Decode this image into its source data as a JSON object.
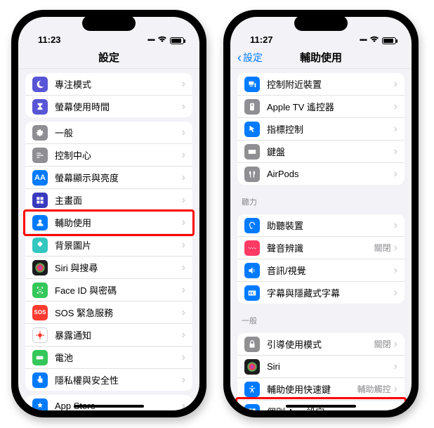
{
  "left": {
    "time": "11:23",
    "title": "設定",
    "groups": [
      {
        "rows": [
          {
            "id": "focus",
            "label": "專注模式",
            "icon": "moon",
            "color": "#5856d6"
          },
          {
            "id": "screentime",
            "label": "螢幕使用時間",
            "icon": "hourglass",
            "color": "#5856d6"
          }
        ]
      },
      {
        "rows": [
          {
            "id": "general",
            "label": "一般",
            "icon": "gear",
            "color": "#8e8e93"
          },
          {
            "id": "controlcenter",
            "label": "控制中心",
            "icon": "sliders",
            "color": "#8e8e93"
          },
          {
            "id": "display",
            "label": "螢幕顯示與亮度",
            "icon": "aa",
            "color": "#007aff"
          },
          {
            "id": "homescreen",
            "label": "主畫面",
            "icon": "grid",
            "color": "#3a3abf"
          },
          {
            "id": "accessibility",
            "label": "輔助使用",
            "icon": "person",
            "color": "#007aff",
            "highlight": true
          },
          {
            "id": "wallpaper",
            "label": "背景圖片",
            "icon": "flower",
            "color": "#34c7c0"
          },
          {
            "id": "siri",
            "label": "Siri 與搜尋",
            "icon": "siri",
            "color": "#1c1c1e"
          },
          {
            "id": "faceid",
            "label": "Face ID 與密碼",
            "icon": "face",
            "color": "#34c759"
          },
          {
            "id": "sos",
            "label": "SOS 緊急服務",
            "icon": "sos",
            "color": "#ff3b30",
            "text": "SOS"
          },
          {
            "id": "exposure",
            "label": "暴露通知",
            "icon": "virus",
            "color": "#ffffff",
            "border": true
          },
          {
            "id": "battery",
            "label": "電池",
            "icon": "batt",
            "color": "#34c759"
          },
          {
            "id": "privacy",
            "label": "隱私權與安全性",
            "icon": "hand",
            "color": "#007aff"
          }
        ]
      },
      {
        "rows": [
          {
            "id": "appstore",
            "label": "App Store",
            "icon": "astore",
            "color": "#007aff"
          }
        ]
      }
    ]
  },
  "right": {
    "time": "11:27",
    "back": "設定",
    "title": "輔助使用",
    "sections": [
      {
        "header": null,
        "rows": [
          {
            "id": "nearby",
            "label": "控制附近裝置",
            "icon": "devices",
            "color": "#007aff"
          },
          {
            "id": "appletv",
            "label": "Apple TV 遙控器",
            "icon": "remote",
            "color": "#8e8e93"
          },
          {
            "id": "pointer",
            "label": "指標控制",
            "icon": "pointer",
            "color": "#007aff"
          },
          {
            "id": "keyboard",
            "label": "鍵盤",
            "icon": "kbd",
            "color": "#8e8e93"
          },
          {
            "id": "airpods",
            "label": "AirPods",
            "icon": "airpods",
            "color": "#8e8e93"
          }
        ]
      },
      {
        "header": "聽力",
        "rows": [
          {
            "id": "hearing",
            "label": "助聽裝置",
            "icon": "ear",
            "color": "#007aff"
          },
          {
            "id": "soundrec",
            "label": "聲音辨識",
            "icon": "wave",
            "color": "#ff3b65",
            "value": "關閉"
          },
          {
            "id": "audiovis",
            "label": "音訊/視覺",
            "icon": "speaker",
            "color": "#007aff"
          },
          {
            "id": "subtitles",
            "label": "字幕與隱藏式字幕",
            "icon": "cc",
            "color": "#007aff"
          }
        ]
      },
      {
        "header": "一般",
        "rows": [
          {
            "id": "guided",
            "label": "引導使用模式",
            "icon": "lock",
            "color": "#8e8e93",
            "value": "關閉"
          },
          {
            "id": "sirigen",
            "label": "Siri",
            "icon": "siri",
            "color": "#1c1c1e"
          },
          {
            "id": "shortcut",
            "label": "輔助使用快速鍵",
            "icon": "acc",
            "color": "#007aff",
            "value": "輔助觸控"
          },
          {
            "id": "perapp",
            "label": "個別 App 設定",
            "icon": "perapp",
            "color": "#007aff",
            "highlight": true
          }
        ]
      }
    ]
  }
}
